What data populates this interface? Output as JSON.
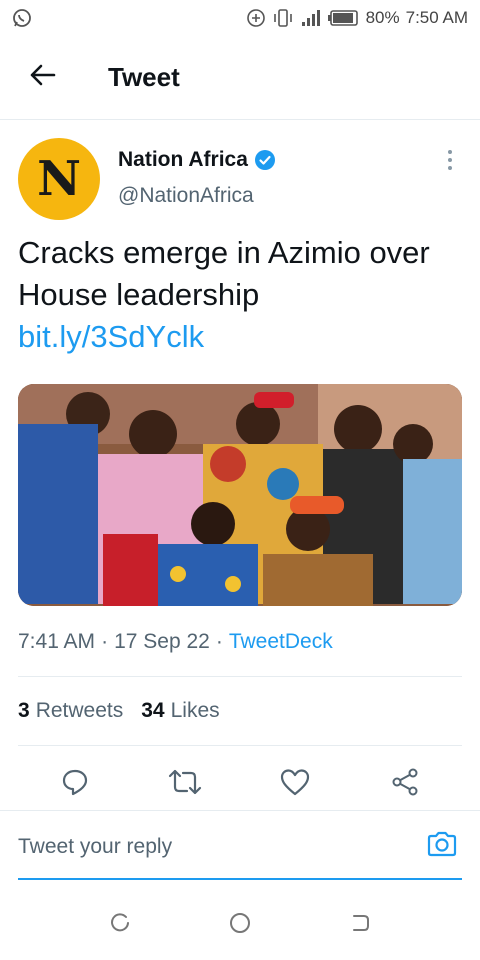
{
  "status_bar": {
    "battery": "80%",
    "time": "7:50 AM"
  },
  "header": {
    "title": "Tweet"
  },
  "tweet": {
    "avatar_letter": "N",
    "author_name": "Nation Africa",
    "author_handle": "@NationAfrica",
    "text": "Cracks emerge in Azimio over House leadership",
    "link": "bit.ly/3SdYclk",
    "time": "7:41 AM",
    "separator": "·",
    "date": "17 Sep 22",
    "source": "TweetDeck",
    "retweets_count": "3",
    "retweets_label": "Retweets",
    "likes_count": "34",
    "likes_label": "Likes"
  },
  "reply": {
    "placeholder": "Tweet your reply"
  },
  "colors": {
    "accent": "#1d9bf0",
    "avatar_bg": "#f6b60f",
    "text": "#0f1419",
    "secondary": "#536471"
  }
}
